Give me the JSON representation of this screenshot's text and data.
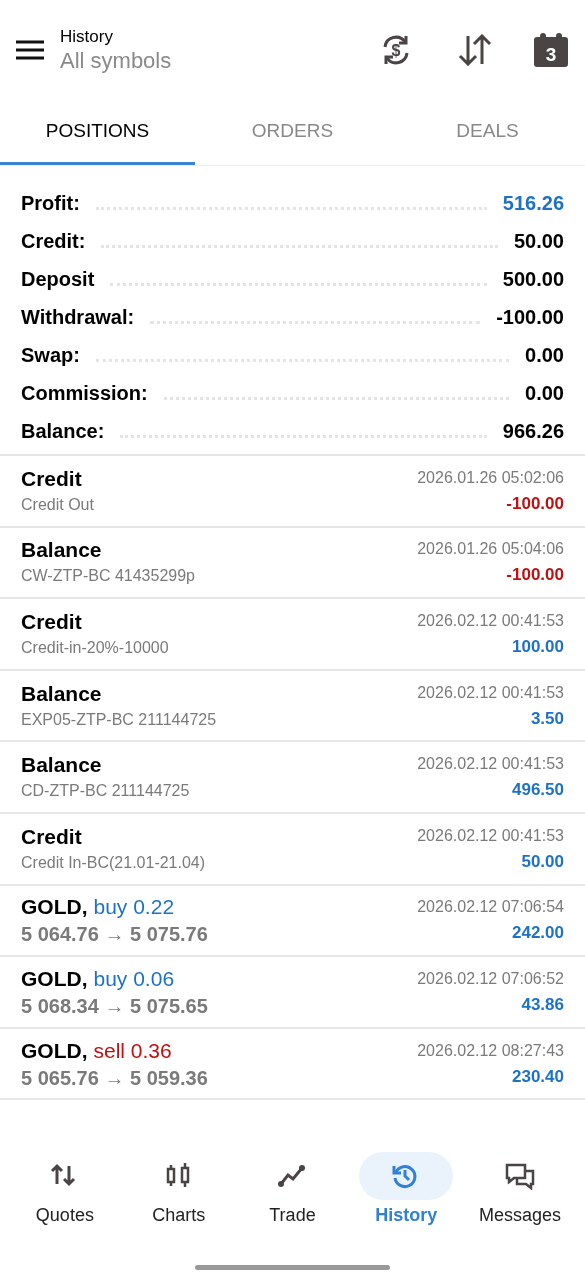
{
  "header": {
    "title": "History",
    "subtitle": "All symbols",
    "exchange_icon_text": "$",
    "calendar_day": "3"
  },
  "tabs": [
    {
      "label": "POSITIONS",
      "selected": true
    },
    {
      "label": "ORDERS",
      "selected": false
    },
    {
      "label": "DEALS",
      "selected": false
    }
  ],
  "summary": [
    {
      "label": "Profit:",
      "value": "516.26",
      "color": "#1d72c8"
    },
    {
      "label": "Credit:",
      "value": "50.00",
      "color": "#000000"
    },
    {
      "label": "Deposit",
      "value": "500.00",
      "color": "#000000"
    },
    {
      "label": "Withdrawal:",
      "value": "-100.00",
      "color": "#000000"
    },
    {
      "label": "Swap:",
      "value": "0.00",
      "color": "#000000"
    },
    {
      "label": "Commission:",
      "value": "0.00",
      "color": "#000000"
    },
    {
      "label": "Balance:",
      "value": "966.26",
      "color": "#000000"
    }
  ],
  "rows": [
    {
      "kind": "operation",
      "title": "Credit",
      "comment": "Credit Out",
      "time": "2026.01.26 05:02:06",
      "amount": "-100.00",
      "color": "#c01010"
    },
    {
      "kind": "operation",
      "title": "Balance",
      "comment": "CW-ZTP-BC 41435299p",
      "time": "2026.01.26 05:04:06",
      "amount": "-100.00",
      "color": "#c01010"
    },
    {
      "kind": "operation",
      "title": "Credit",
      "comment": "Credit-in-20%-10000",
      "time": "2026.02.12 00:41:53",
      "amount": "100.00",
      "color": "#1d72c8"
    },
    {
      "kind": "operation",
      "title": "Balance",
      "comment": "EXP05-ZTP-BC 211144725",
      "time": "2026.02.12 00:41:53",
      "amount": "3.50",
      "color": "#1d72c8"
    },
    {
      "kind": "operation",
      "title": "Balance",
      "comment": "CD-ZTP-BC 211144725",
      "time": "2026.02.12 00:41:53",
      "amount": "496.50",
      "color": "#1d72c8"
    },
    {
      "kind": "operation",
      "title": "Credit",
      "comment": "Credit In-BC(21.01-21.04)",
      "time": "2026.02.12 00:41:53",
      "amount": "50.00",
      "color": "#1d72c8"
    },
    {
      "kind": "trade",
      "symbol": "GOLD,",
      "side": {
        "text": "buy 0.22",
        "color": "#1d72c8"
      },
      "prices": "5 064.76 → 5 075.76",
      "time": "2026.02.12 07:06:54",
      "amount": "242.00",
      "color": "#1d72c8"
    },
    {
      "kind": "trade",
      "symbol": "GOLD,",
      "side": {
        "text": "buy 0.06",
        "color": "#1d72c8"
      },
      "prices": "5 068.34 → 5 075.65",
      "time": "2026.02.12 07:06:52",
      "amount": "43.86",
      "color": "#1d72c8"
    },
    {
      "kind": "trade",
      "symbol": "GOLD,",
      "side": {
        "text": "sell 0.36",
        "color": "#c01010"
      },
      "prices": "5 065.76 → 5 059.36",
      "time": "2026.02.12 08:27:43",
      "amount": "230.40",
      "color": "#1d72c8"
    }
  ],
  "nav": [
    {
      "label": "Quotes",
      "selected": false
    },
    {
      "label": "Charts",
      "selected": false
    },
    {
      "label": "Trade",
      "selected": false
    },
    {
      "label": "History",
      "selected": true
    },
    {
      "label": "Messages",
      "selected": false
    }
  ]
}
